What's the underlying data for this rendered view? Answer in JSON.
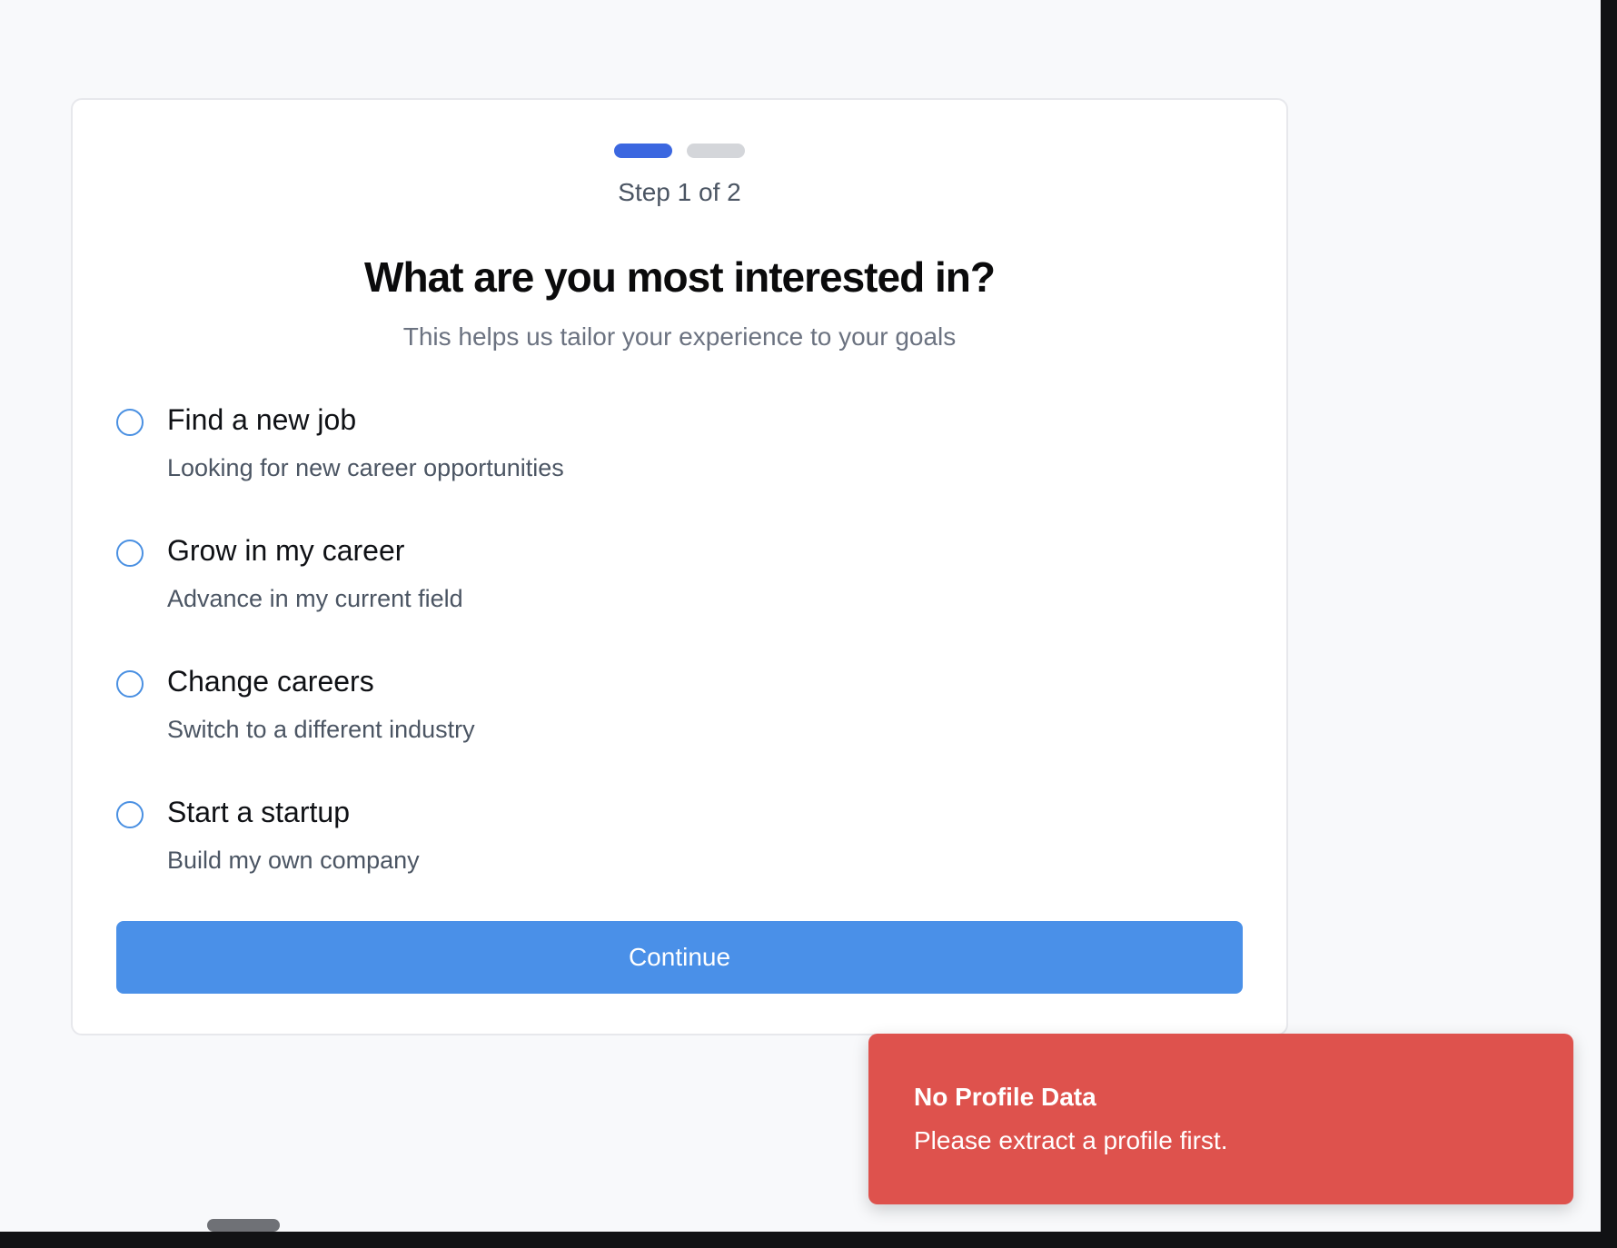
{
  "stepper": {
    "current_step": 1,
    "total_steps": 2,
    "label": "Step 1 of 2",
    "active_color": "#3b67e0",
    "inactive_color": "#d4d6da"
  },
  "heading": {
    "title": "What are you most interested in?",
    "subtitle": "This helps us tailor your experience to your goals"
  },
  "options": [
    {
      "title": "Find a new job",
      "description": "Looking for new career opportunities",
      "selected": false
    },
    {
      "title": "Grow in my career",
      "description": "Advance in my current field",
      "selected": false
    },
    {
      "title": "Change careers",
      "description": "Switch to a different industry",
      "selected": false
    },
    {
      "title": "Start a startup",
      "description": "Build my own company",
      "selected": false
    }
  ],
  "actions": {
    "continue_label": "Continue",
    "accent_color": "#4a90e8"
  },
  "toast": {
    "title": "No Profile Data",
    "message": "Please extract a profile first.",
    "color": "#de524d"
  }
}
